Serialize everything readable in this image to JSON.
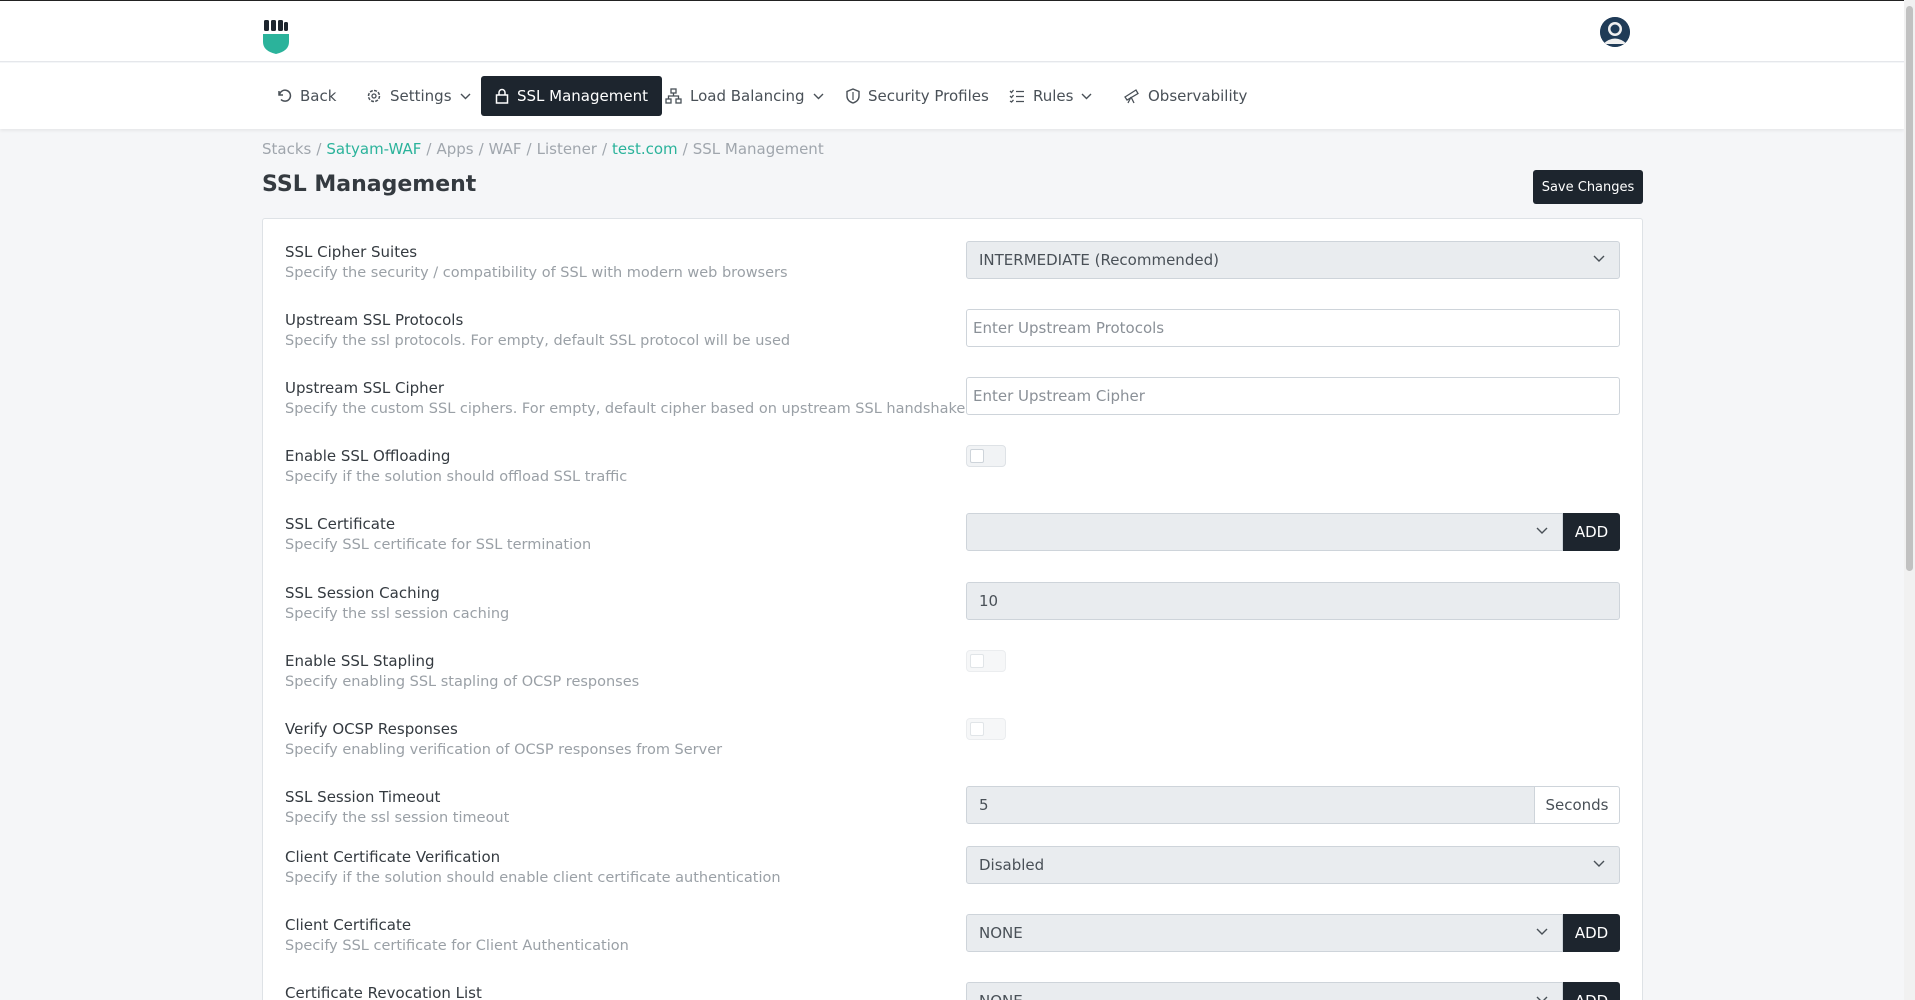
{
  "nav": {
    "back": "Back",
    "settings": "Settings",
    "ssl_management": "SSL Management",
    "load_balancing": "Load Balancing",
    "security_profiles": "Security Profiles",
    "rules": "Rules",
    "observability": "Observability"
  },
  "breadcrumb": {
    "items": [
      "Stacks",
      "Satyam-WAF",
      "Apps",
      "WAF",
      "Listener",
      "test.com",
      "SSL Management"
    ],
    "separator": "/"
  },
  "page": {
    "title": "SSL Management",
    "save_label": "Save Changes"
  },
  "fields": {
    "cipher_suites": {
      "label": "SSL Cipher Suites",
      "desc": "Specify the security / compatibility of SSL with modern web browsers",
      "value": "INTERMEDIATE (Recommended)"
    },
    "upstream_protocols": {
      "label": "Upstream SSL Protocols",
      "desc": "Specify the ssl protocols. For empty, default SSL protocol will be used",
      "placeholder": "Enter Upstream Protocols"
    },
    "upstream_cipher": {
      "label": "Upstream SSL Cipher",
      "desc": "Specify the custom SSL ciphers. For empty, default cipher based on upstream SSL handshake",
      "placeholder": "Enter Upstream Cipher"
    },
    "ssl_offloading": {
      "label": "Enable SSL Offloading",
      "desc": "Specify if the solution should offload SSL traffic",
      "enabled": false
    },
    "ssl_certificate": {
      "label": "SSL Certificate",
      "desc": "Specify SSL certificate for SSL termination",
      "value": "",
      "add_label": "ADD"
    },
    "session_caching": {
      "label": "SSL Session Caching",
      "desc": "Specify the ssl session caching",
      "value": "10"
    },
    "ssl_stapling": {
      "label": "Enable SSL Stapling",
      "desc": "Specify enabling SSL stapling of OCSP responses",
      "enabled": false
    },
    "verify_ocsp": {
      "label": "Verify OCSP Responses",
      "desc": "Specify enabling verification of OCSP responses from Server",
      "enabled": false
    },
    "session_timeout": {
      "label": "SSL Session Timeout",
      "desc": "Specify the ssl session timeout",
      "value": "5",
      "unit": "Seconds"
    },
    "client_verification": {
      "label": "Client Certificate Verification",
      "desc": "Specify if the solution should enable client certificate authentication",
      "value": "Disabled"
    },
    "client_certificate": {
      "label": "Client Certificate",
      "desc": "Specify SSL certificate for Client Authentication",
      "value": "NONE",
      "add_label": "ADD"
    },
    "revocation_list": {
      "label": "Certificate Revocation List",
      "value": "NONE",
      "add_label": "ADD"
    }
  },
  "colors": {
    "primary_dark": "#1d252e",
    "accent": "#2bb39b"
  }
}
